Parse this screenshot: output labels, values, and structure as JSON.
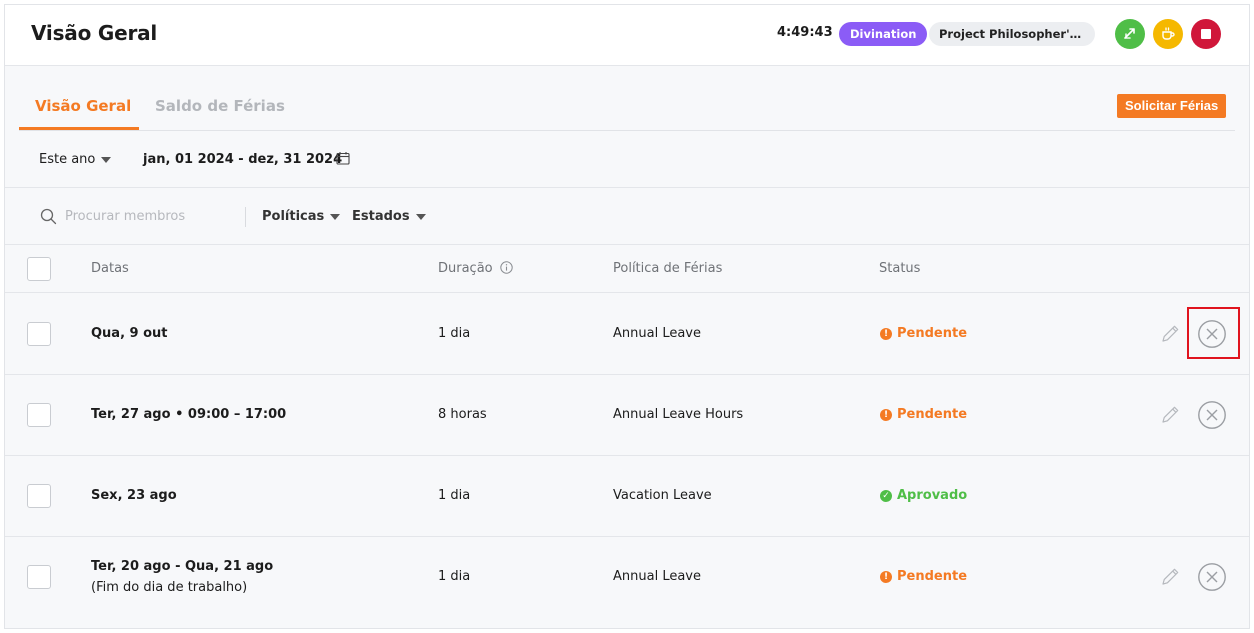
{
  "header": {
    "title": "Visão Geral",
    "timer": "4:49:43",
    "project_tag": "Divination",
    "project_name": "Project Philosopher's S...",
    "actions": [
      {
        "name": "switch-icon",
        "color": "#4fbe47"
      },
      {
        "name": "coffee-icon",
        "color": "#f5b800"
      },
      {
        "name": "stop-icon",
        "color": "#d0173a"
      }
    ]
  },
  "tabs": [
    {
      "label": "Visão Geral",
      "active": true
    },
    {
      "label": "Saldo de Férias",
      "active": false
    }
  ],
  "request_button": "Solicitar Férias",
  "date_filter": {
    "period": "Este ano",
    "range": "jan, 01 2024 - dez, 31 2024"
  },
  "search": {
    "placeholder": "Procurar membros",
    "value": ""
  },
  "filters": {
    "policies": "Políticas",
    "states": "Estados"
  },
  "table": {
    "columns": {
      "dates": "Datas",
      "duration": "Duração",
      "policy": "Política de Férias",
      "status": "Status"
    },
    "rows": [
      {
        "date": "Qua, 9 out",
        "sub": "",
        "duration": "1 dia",
        "policy": "Annual Leave",
        "status": "Pendente",
        "status_type": "pending",
        "actions": true
      },
      {
        "date": "Ter, 27 ago • 09:00 – 17:00",
        "sub": "",
        "duration": "8 horas",
        "policy": "Annual Leave Hours",
        "status": "Pendente",
        "status_type": "pending",
        "actions": true
      },
      {
        "date": "Sex, 23 ago",
        "sub": "",
        "duration": "1 dia",
        "policy": "Vacation Leave",
        "status": "Aprovado",
        "status_type": "approved",
        "actions": false
      },
      {
        "date": "Ter, 20 ago - Qua, 21 ago",
        "sub": "(Fim do dia de trabalho)",
        "duration": "1 dia",
        "policy": "Annual Leave",
        "status": "Pendente",
        "status_type": "pending",
        "actions": true
      }
    ]
  },
  "colors": {
    "accent": "#f47a23",
    "approved": "#4fbe47",
    "tag": "#8b5cf6"
  }
}
